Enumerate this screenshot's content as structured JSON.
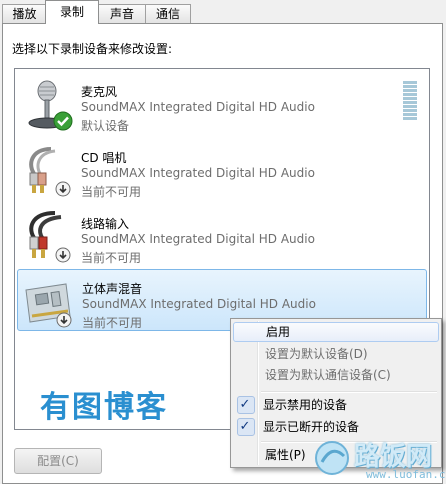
{
  "tabs": [
    {
      "label": "播放"
    },
    {
      "label": "录制"
    },
    {
      "label": "声音"
    },
    {
      "label": "通信"
    }
  ],
  "active_tab": "录制",
  "prompt": "选择以下录制设备来修改设置:",
  "devices": [
    {
      "name": "麦克风",
      "driver": "SoundMAX Integrated Digital HD Audio",
      "status": "默认设备",
      "icon": "microphone-icon",
      "badge": "default-check-badge"
    },
    {
      "name": "CD 唱机",
      "driver": "SoundMAX Integrated Digital HD Audio",
      "status": "当前不可用",
      "icon": "cd-player-cable-icon",
      "badge": "unavailable-badge"
    },
    {
      "name": "线路输入",
      "driver": "SoundMAX Integrated Digital HD Audio",
      "status": "当前不可用",
      "icon": "line-in-cable-icon",
      "badge": "unavailable-badge"
    },
    {
      "name": "立体声混音",
      "driver": "SoundMAX Integrated Digital HD Audio",
      "status": "当前不可用",
      "icon": "sound-card-icon",
      "badge": "unavailable-badge"
    }
  ],
  "overlay_watermark": "有图博客",
  "configure_button": "配置(C)",
  "context_menu": {
    "items": [
      {
        "label": "启用",
        "state": "hover"
      },
      {
        "label": "设置为默认设备(D)",
        "state": "disabled"
      },
      {
        "label": "设置为默认通信设备(C)",
        "state": "disabled"
      },
      {
        "label": "显示禁用的设备",
        "checked": true
      },
      {
        "label": "显示已断开的设备",
        "checked": true
      },
      {
        "label": "属性(P)",
        "state": "normal"
      }
    ]
  },
  "brand": {
    "name": "路饭网",
    "url": "www.luofan.com"
  },
  "colors": {
    "selection": "#cce6fb",
    "watermark": "#2a8fd0",
    "check": "#3aa038"
  }
}
